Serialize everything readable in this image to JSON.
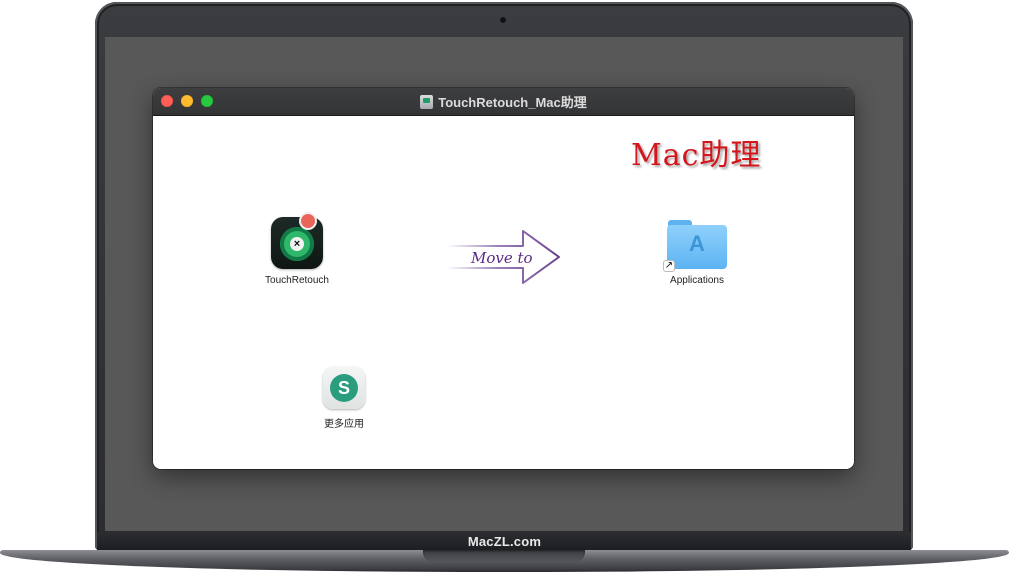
{
  "window": {
    "title": "TouchRetouch_Mac助理"
  },
  "watermark": "Mac助理",
  "items": {
    "app": {
      "label": "TouchRetouch",
      "icon": "touchretouch-app-icon"
    },
    "applications": {
      "label": "Applications",
      "icon": "applications-folder-icon"
    },
    "more": {
      "label": "更多应用",
      "icon": "more-apps-icon"
    }
  },
  "arrow": {
    "label": "Move to"
  },
  "laptop": {
    "brand": "MacZL.com"
  },
  "colors": {
    "close": "#ff5f57",
    "minimize": "#febc2e",
    "maximize": "#28c840",
    "watermark": "#d3161b",
    "arrow_text": "#5b2a86"
  }
}
